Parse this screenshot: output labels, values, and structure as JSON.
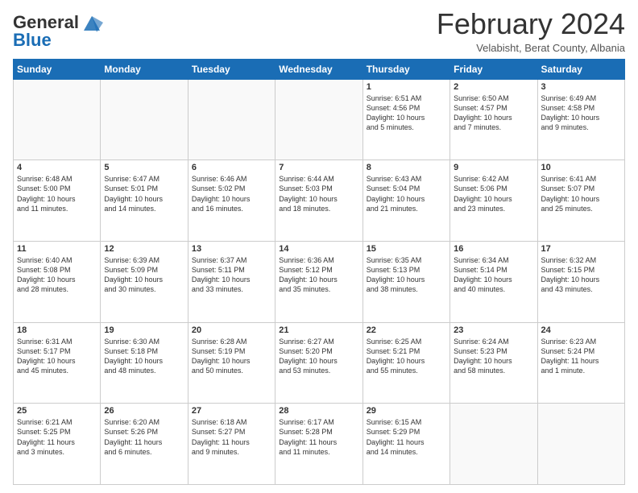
{
  "header": {
    "logo_general": "General",
    "logo_blue": "Blue",
    "month_title": "February 2024",
    "subtitle": "Velabisht, Berat County, Albania"
  },
  "calendar": {
    "days_of_week": [
      "Sunday",
      "Monday",
      "Tuesday",
      "Wednesday",
      "Thursday",
      "Friday",
      "Saturday"
    ],
    "weeks": [
      [
        {
          "day": "",
          "info": ""
        },
        {
          "day": "",
          "info": ""
        },
        {
          "day": "",
          "info": ""
        },
        {
          "day": "",
          "info": ""
        },
        {
          "day": "1",
          "info": "Sunrise: 6:51 AM\nSunset: 4:56 PM\nDaylight: 10 hours\nand 5 minutes."
        },
        {
          "day": "2",
          "info": "Sunrise: 6:50 AM\nSunset: 4:57 PM\nDaylight: 10 hours\nand 7 minutes."
        },
        {
          "day": "3",
          "info": "Sunrise: 6:49 AM\nSunset: 4:58 PM\nDaylight: 10 hours\nand 9 minutes."
        }
      ],
      [
        {
          "day": "4",
          "info": "Sunrise: 6:48 AM\nSunset: 5:00 PM\nDaylight: 10 hours\nand 11 minutes."
        },
        {
          "day": "5",
          "info": "Sunrise: 6:47 AM\nSunset: 5:01 PM\nDaylight: 10 hours\nand 14 minutes."
        },
        {
          "day": "6",
          "info": "Sunrise: 6:46 AM\nSunset: 5:02 PM\nDaylight: 10 hours\nand 16 minutes."
        },
        {
          "day": "7",
          "info": "Sunrise: 6:44 AM\nSunset: 5:03 PM\nDaylight: 10 hours\nand 18 minutes."
        },
        {
          "day": "8",
          "info": "Sunrise: 6:43 AM\nSunset: 5:04 PM\nDaylight: 10 hours\nand 21 minutes."
        },
        {
          "day": "9",
          "info": "Sunrise: 6:42 AM\nSunset: 5:06 PM\nDaylight: 10 hours\nand 23 minutes."
        },
        {
          "day": "10",
          "info": "Sunrise: 6:41 AM\nSunset: 5:07 PM\nDaylight: 10 hours\nand 25 minutes."
        }
      ],
      [
        {
          "day": "11",
          "info": "Sunrise: 6:40 AM\nSunset: 5:08 PM\nDaylight: 10 hours\nand 28 minutes."
        },
        {
          "day": "12",
          "info": "Sunrise: 6:39 AM\nSunset: 5:09 PM\nDaylight: 10 hours\nand 30 minutes."
        },
        {
          "day": "13",
          "info": "Sunrise: 6:37 AM\nSunset: 5:11 PM\nDaylight: 10 hours\nand 33 minutes."
        },
        {
          "day": "14",
          "info": "Sunrise: 6:36 AM\nSunset: 5:12 PM\nDaylight: 10 hours\nand 35 minutes."
        },
        {
          "day": "15",
          "info": "Sunrise: 6:35 AM\nSunset: 5:13 PM\nDaylight: 10 hours\nand 38 minutes."
        },
        {
          "day": "16",
          "info": "Sunrise: 6:34 AM\nSunset: 5:14 PM\nDaylight: 10 hours\nand 40 minutes."
        },
        {
          "day": "17",
          "info": "Sunrise: 6:32 AM\nSunset: 5:15 PM\nDaylight: 10 hours\nand 43 minutes."
        }
      ],
      [
        {
          "day": "18",
          "info": "Sunrise: 6:31 AM\nSunset: 5:17 PM\nDaylight: 10 hours\nand 45 minutes."
        },
        {
          "day": "19",
          "info": "Sunrise: 6:30 AM\nSunset: 5:18 PM\nDaylight: 10 hours\nand 48 minutes."
        },
        {
          "day": "20",
          "info": "Sunrise: 6:28 AM\nSunset: 5:19 PM\nDaylight: 10 hours\nand 50 minutes."
        },
        {
          "day": "21",
          "info": "Sunrise: 6:27 AM\nSunset: 5:20 PM\nDaylight: 10 hours\nand 53 minutes."
        },
        {
          "day": "22",
          "info": "Sunrise: 6:25 AM\nSunset: 5:21 PM\nDaylight: 10 hours\nand 55 minutes."
        },
        {
          "day": "23",
          "info": "Sunrise: 6:24 AM\nSunset: 5:23 PM\nDaylight: 10 hours\nand 58 minutes."
        },
        {
          "day": "24",
          "info": "Sunrise: 6:23 AM\nSunset: 5:24 PM\nDaylight: 11 hours\nand 1 minute."
        }
      ],
      [
        {
          "day": "25",
          "info": "Sunrise: 6:21 AM\nSunset: 5:25 PM\nDaylight: 11 hours\nand 3 minutes."
        },
        {
          "day": "26",
          "info": "Sunrise: 6:20 AM\nSunset: 5:26 PM\nDaylight: 11 hours\nand 6 minutes."
        },
        {
          "day": "27",
          "info": "Sunrise: 6:18 AM\nSunset: 5:27 PM\nDaylight: 11 hours\nand 9 minutes."
        },
        {
          "day": "28",
          "info": "Sunrise: 6:17 AM\nSunset: 5:28 PM\nDaylight: 11 hours\nand 11 minutes."
        },
        {
          "day": "29",
          "info": "Sunrise: 6:15 AM\nSunset: 5:29 PM\nDaylight: 11 hours\nand 14 minutes."
        },
        {
          "day": "",
          "info": ""
        },
        {
          "day": "",
          "info": ""
        }
      ]
    ]
  }
}
